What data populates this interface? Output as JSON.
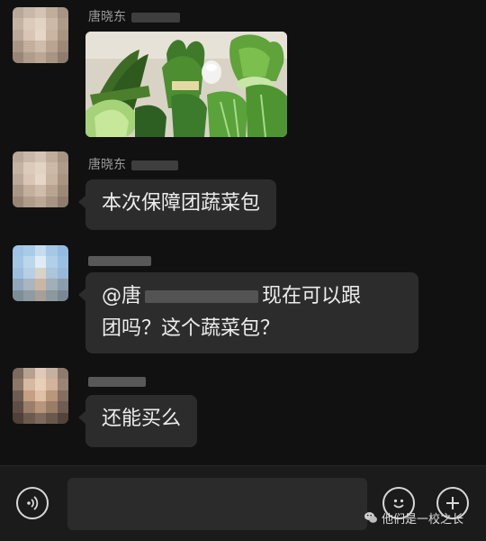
{
  "messages": [
    {
      "sender": "唐晓东",
      "type": "image",
      "image_icon": "vegetables-photo"
    },
    {
      "sender": "唐晓东",
      "type": "text",
      "text": "本次保障团蔬菜包"
    },
    {
      "sender": "",
      "type": "text",
      "mention": "@唐",
      "text_line1": "现在可以跟",
      "text_line2": "团吗？这个蔬菜包？"
    },
    {
      "sender": "",
      "type": "text",
      "text": "还能买么"
    }
  ],
  "input_bar": {
    "voice_icon": "voice-icon",
    "emoji_icon": "emoji-icon",
    "plus_icon": "plus-icon"
  },
  "watermark": {
    "text": "他们是一校之长",
    "icon": "wechat-logo"
  }
}
